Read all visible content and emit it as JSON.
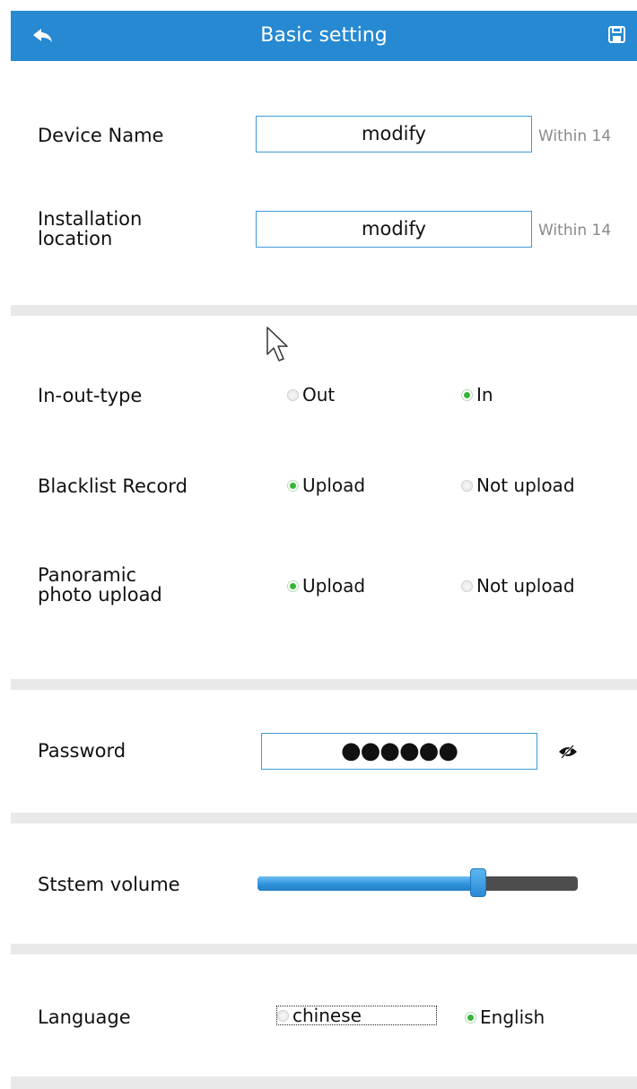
{
  "header": {
    "title": "Basic setting",
    "back_icon": "back-arrow-icon",
    "save_icon": "floppy-save-icon",
    "color": "#2689d2"
  },
  "device_name": {
    "label": "Device Name",
    "value": "modify",
    "hint": "Within 14"
  },
  "installation_location": {
    "label_line1": "Installation",
    "label_line2": "location",
    "value": "modify",
    "hint": "Within 14"
  },
  "in_out_type": {
    "label": "In-out-type",
    "options": [
      {
        "label": "Out",
        "selected": false
      },
      {
        "label": "In",
        "selected": true
      }
    ]
  },
  "blacklist_record": {
    "label": "Blacklist Record",
    "options": [
      {
        "label": "Upload",
        "selected": true
      },
      {
        "label": "Not upload",
        "selected": false
      }
    ]
  },
  "panoramic": {
    "label_line1": "Panoramic",
    "label_line2": "photo upload",
    "options": [
      {
        "label": "Upload",
        "selected": true
      },
      {
        "label": "Not upload",
        "selected": false
      }
    ]
  },
  "password": {
    "label": "Password",
    "value": "●●●●●●",
    "toggle_icon": "eye-hidden-icon"
  },
  "volume": {
    "label": "Ststem volume",
    "level_fraction": 0.69
  },
  "language": {
    "label": "Language",
    "options": [
      {
        "label": "chinese",
        "selected": false
      },
      {
        "label": "English",
        "selected": true
      }
    ]
  },
  "colors": {
    "accent": "#2689d2",
    "radio_selected": "#35b53a",
    "separator": "#e9e9e9",
    "input_border": "#3e9ad9"
  }
}
